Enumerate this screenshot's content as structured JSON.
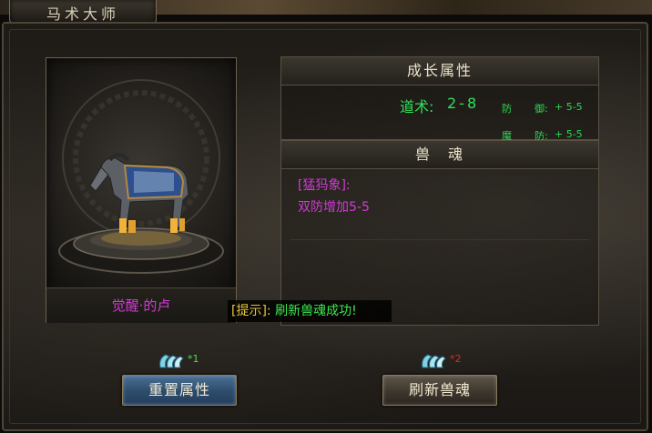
{
  "window": {
    "title": "马术大师"
  },
  "portrait": {
    "caption": "觉醒·的卢"
  },
  "growth": {
    "header": "成长属性",
    "taoist_label": "道术:",
    "taoist_value": "2-8",
    "def_label": "防",
    "def_label2": "御:",
    "def_value": "+ 5-5",
    "mdef_label": "魔",
    "mdef_label2": "防:",
    "mdef_value": "+ 5-5"
  },
  "soul": {
    "header": "兽　魂",
    "name": "[猛犸象]:",
    "effect": "双防增加5-5"
  },
  "tip": {
    "label": "[提示]:",
    "message": "刷新兽魂成功!"
  },
  "costs": {
    "reset_count": "*1",
    "refresh_count": "*2"
  },
  "buttons": {
    "reset_label": "重置属性",
    "refresh_label": "刷新兽魂"
  },
  "colors": {
    "purple_text": "#d23bd6",
    "green_text": "#2fe05a",
    "tip_yellow": "#e6c63a",
    "cost_ok": "#3be84d",
    "cost_insufficient": "#e02a2a"
  },
  "icons": {
    "cost_item": "soul-crystal-icon"
  }
}
